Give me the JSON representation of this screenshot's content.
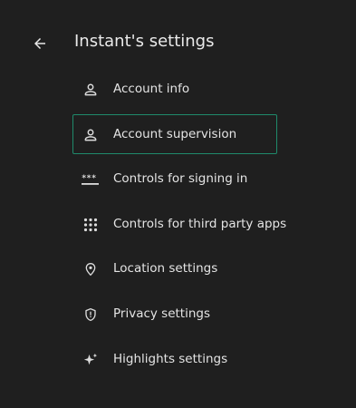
{
  "header": {
    "title": "Instant's settings",
    "back_icon": "arrow-left-icon"
  },
  "colors": {
    "background": "#1f1f1f",
    "selection_border": "#1f8a6b",
    "text": "#e4e4e4"
  },
  "menu": {
    "selected_index": 1,
    "items": [
      {
        "label": "Account info",
        "icon": "person-icon"
      },
      {
        "label": "Account supervision",
        "icon": "person-icon"
      },
      {
        "label": "Controls for signing in",
        "icon": "password-icon"
      },
      {
        "label": "Controls for third party apps",
        "icon": "apps-grid-icon"
      },
      {
        "label": "Location settings",
        "icon": "location-pin-icon"
      },
      {
        "label": "Privacy settings",
        "icon": "shield-icon"
      },
      {
        "label": "Highlights settings",
        "icon": "sparkle-icon"
      }
    ]
  }
}
